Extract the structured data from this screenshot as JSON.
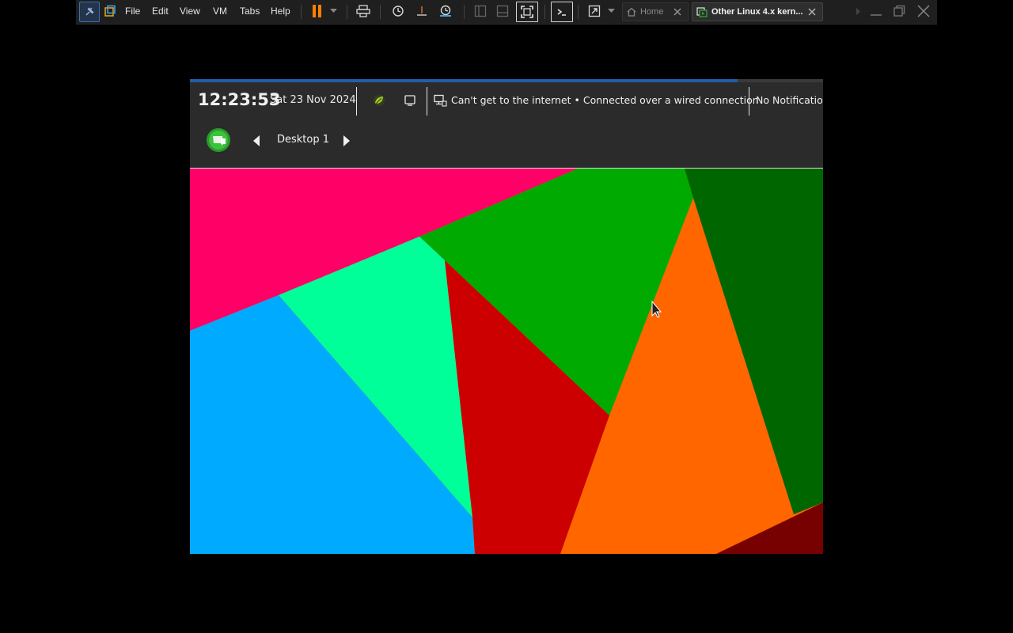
{
  "host": {
    "menu": [
      "File",
      "Edit",
      "View",
      "VM",
      "Tabs",
      "Help"
    ],
    "tabs": [
      {
        "label": "Home",
        "active": false
      },
      {
        "label": "Other Linux 4.x kern...",
        "active": true
      }
    ],
    "colors": {
      "toolbar_bg": "#1f1f1f",
      "pause_icon": "#ff7f00",
      "active_tab_bg": "#2e2e2e"
    }
  },
  "guest": {
    "boot_progress": 0.865,
    "panel": {
      "clock": "12:23:53",
      "date": "Sat 23 Nov 2024",
      "network_status": "Can't get to the internet • Connected over a wired connection",
      "notifications": "No Notifications",
      "desktop_label": "Desktop 1"
    },
    "wallpaper_colors": [
      "#ff0066",
      "#00aa00",
      "#006600",
      "#00ff99",
      "#00aaff",
      "#cc0000",
      "#ff6600",
      "#770000"
    ]
  }
}
